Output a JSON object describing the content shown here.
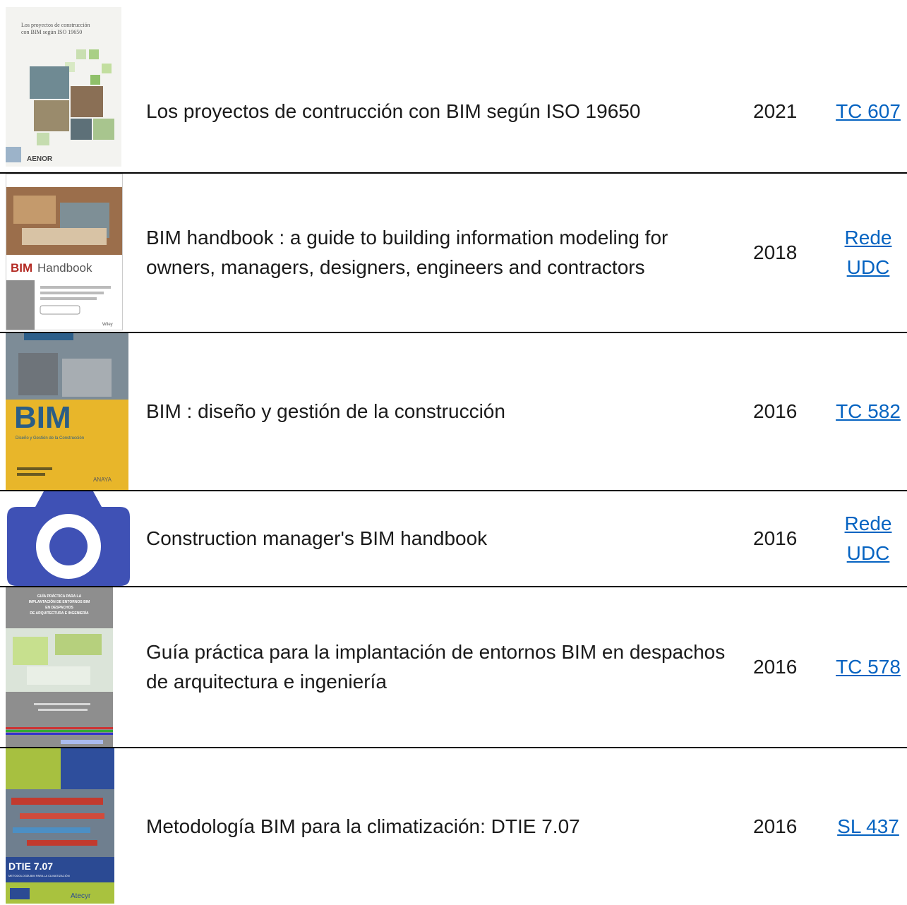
{
  "books": [
    {
      "title": "Los proyectos de contrucción con BIM según ISO 19650",
      "year": "2021",
      "call_number": "TC 607",
      "cover_text": [
        "Los proyectos de construcción",
        "con BIM según ISO 19650"
      ],
      "cover_brand": "AENOR"
    },
    {
      "title": "BIM handbook : a guide to building information modeling for owners, managers, designers, engineers and contractors",
      "year": "2018",
      "call_number": "Rede UDC",
      "cover_text": [
        "BIM",
        "Handbook"
      ],
      "cover_brand": "Wiley"
    },
    {
      "title": "BIM : diseño y gestión de la construcción",
      "year": "2016",
      "call_number": "TC 582",
      "cover_text": [
        "BIM",
        "Diseño y Gestión de la Construcción"
      ],
      "cover_brand": "ANAYA"
    },
    {
      "title": "Construction manager's BIM handbook",
      "year": "2016",
      "call_number": "Rede UDC",
      "cover_icon": "camera-icon",
      "cover_color": "#3f51b5"
    },
    {
      "title": "Guía práctica para la implantación de entornos BIM en despachos de arquitectura e ingeniería",
      "year": "2016",
      "call_number": "TC 578",
      "cover_text": [
        "GUÍA PRÁCTICA PARA LA",
        "IMPLANTACIÓN DE ENTORNOS BIM",
        "EN DESPACHOS",
        "DE ARQUITECTURA E INGENIERÍA"
      ]
    },
    {
      "title": "Metodología BIM para la climatización: DTIE 7.07",
      "year": "2016",
      "call_number": "SL 437",
      "cover_text": [
        "DTIE 7.07",
        "METODOLOGÍA BIM PARA LA CLIMATIZACIÓN"
      ],
      "cover_brand": "Atecyr"
    }
  ]
}
